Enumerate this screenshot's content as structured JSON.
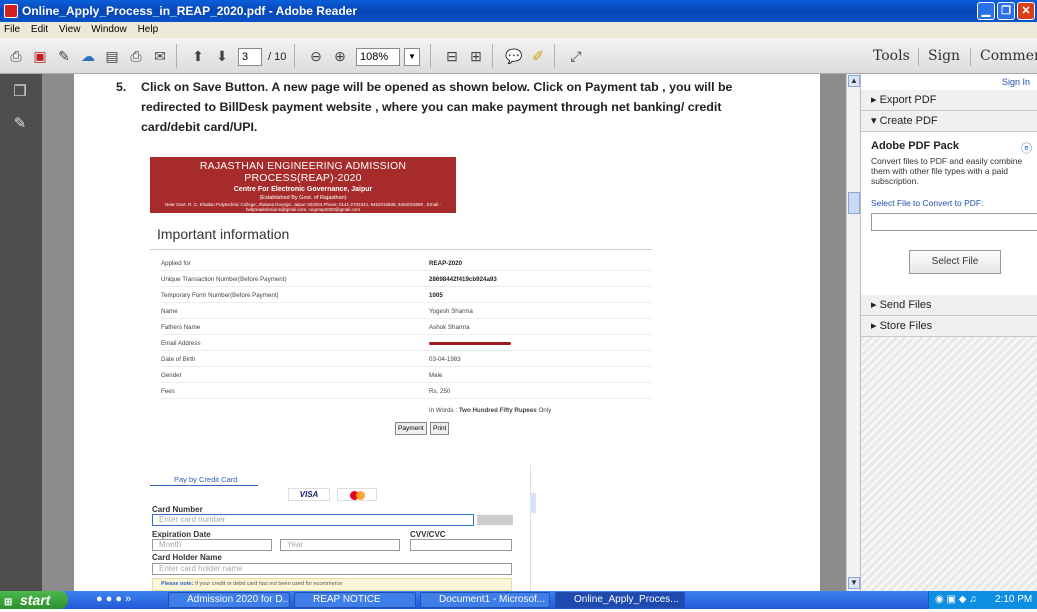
{
  "window": {
    "title": "Online_Apply_Process_in_REAP_2020.pdf - Adobe Reader"
  },
  "menu": [
    "File",
    "Edit",
    "View",
    "Window",
    "Help"
  ],
  "toolbar": {
    "page_current": "3",
    "page_total": "/ 10",
    "zoom": "108%",
    "tabs": {
      "tools": "Tools",
      "sign": "Sign",
      "comment": "Comment"
    }
  },
  "document": {
    "step_number": "5.",
    "step_lines": [
      "Click on Save Button. A new page will be opened as shown below. Click on Payment tab , you will be",
      "redirected to BillDesk payment website , where you can make payment through net banking/ credit",
      "card/debit card/UPI."
    ],
    "banner": {
      "title": "RAJASTHAN ENGINEERING ADMISSION PROCESS(REAP)-2020",
      "subtitle": "Centre For Electronic Governance, Jaipur",
      "established": "(Established By Govt. of Rajasthan)",
      "address_1": "Near Govt. R. C. Khaitan Polytechnic College, Jhalana Doongri, Jaipur-302004 Phone: 0141-2702344, 9462015508, 9462015080 , Email -",
      "address_2": "helpreadmissions@gmail.com, cegreap2020@gmail.com"
    },
    "info_heading": "Important information",
    "rows": [
      {
        "label": "Applied for",
        "value": "REAP-2020",
        "bold": true
      },
      {
        "label": "Unique Transaction Number(Before Payment)",
        "value": "28698442f419cb924a93",
        "bold": true
      },
      {
        "label": "Temporary Form Number(Before Payment)",
        "value": "1005",
        "bold": true
      },
      {
        "label": "Name",
        "value": "Yogesh Sharma",
        "bold": false
      },
      {
        "label": "Fathers Name",
        "value": "Ashok Sharma",
        "bold": false
      },
      {
        "label": "Email Address",
        "value": "",
        "bold": false
      },
      {
        "label": "Date of Birth",
        "value": "03-04-1983",
        "bold": false
      },
      {
        "label": "Gender",
        "value": "Male",
        "bold": false
      },
      {
        "label": "Fees",
        "value": "Rs. 250",
        "bold": false
      }
    ],
    "in_words_prefix": "In Words :",
    "in_words_bold": "Two Hundred Fifty Rupees",
    "in_words_suffix": "Only",
    "payment_button": "Payment",
    "print_button": "Print",
    "card": {
      "pay_by": "Pay by Credit Card",
      "visa": "VISA",
      "card_number_label": "Card Number",
      "card_number_placeholder": "Enter card number",
      "expiration_label": "Expiration Date",
      "cvv_label": "CVV/CVC",
      "month_placeholder": "Month",
      "year_placeholder": "Year",
      "holder_label": "Card Holder Name",
      "holder_placeholder": "Enter card holder name",
      "note_bold": "Please note:",
      "note_text": "If your credit or debit card has not been used for ecommerce"
    }
  },
  "right_panel": {
    "sign_in": "Sign In",
    "export_pdf": "Export PDF",
    "create_pdf": "Create PDF",
    "pack_title": "Adobe PDF Pack",
    "pack_desc": "Convert files to PDF and easily combine them with other file types with a paid subscription.",
    "select_convert": "Select File to Convert to PDF:",
    "select_file_button": "Select File",
    "send_files": "Send Files",
    "store_files": "Store Files"
  },
  "taskbar": {
    "start": "start",
    "tasks": [
      "Admission 2020 for D...",
      "REAP NOTICE",
      "Document1 - Microsof...",
      "Online_Apply_Proces..."
    ],
    "time": "2:10 PM"
  }
}
